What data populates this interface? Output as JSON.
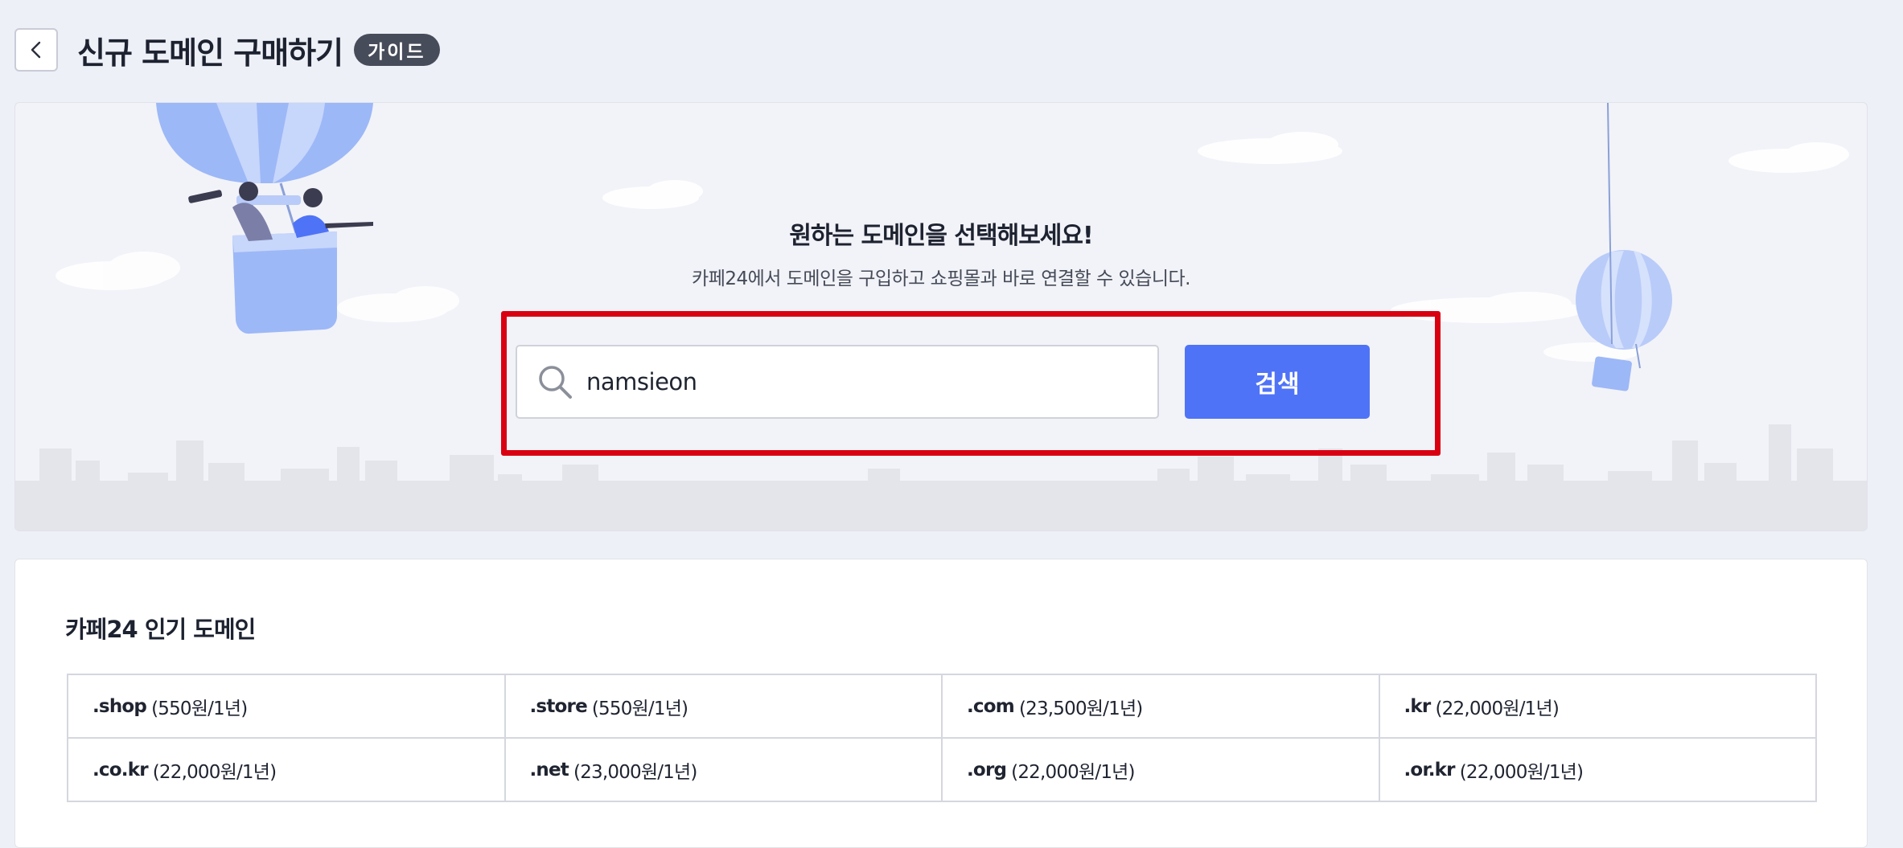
{
  "header": {
    "title": "신규 도메인 구매하기",
    "guide_label": "가이드"
  },
  "hero": {
    "title": "원하는 도메인을 선택해보세요!",
    "subtitle": "카페24에서 도메인을 구입하고 쇼핑몰과 바로 연결할 수 있습니다.",
    "search": {
      "value": "namsieon",
      "button_label": "검색"
    }
  },
  "popular": {
    "title": "카페24 인기 도메인",
    "domains": [
      {
        "tld": ".shop",
        "price": "(550원/1년)"
      },
      {
        "tld": ".store",
        "price": "(550원/1년)"
      },
      {
        "tld": ".com",
        "price": "(23,500원/1년)"
      },
      {
        "tld": ".kr",
        "price": "(22,000원/1년)"
      },
      {
        "tld": ".co.kr",
        "price": "(22,000원/1년)"
      },
      {
        "tld": ".net",
        "price": "(23,000원/1년)"
      },
      {
        "tld": ".org",
        "price": "(22,000원/1년)"
      },
      {
        "tld": ".or.kr",
        "price": "(22,000원/1년)"
      }
    ]
  },
  "colors": {
    "accent": "#4f73f7",
    "highlight_frame": "#d90012",
    "badge": "#474c5a",
    "background": "#eef0f7"
  }
}
